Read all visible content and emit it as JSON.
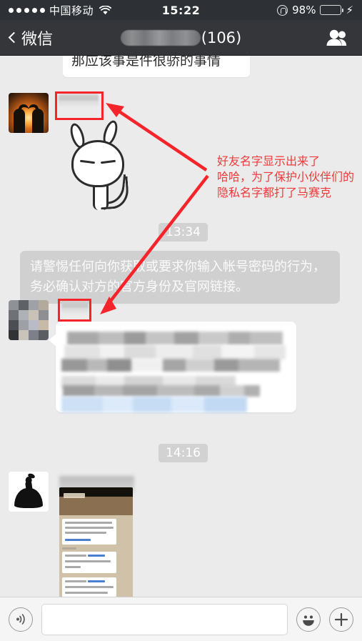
{
  "status_bar": {
    "signal_dots": 5,
    "carrier": "中国移动",
    "wifi_icon": "wifi-icon",
    "time": "15:22",
    "rotation_lock_icon": "rotation-lock-icon",
    "battery_percent": "98%",
    "battery_level": 98,
    "battery_color": "#4cd964",
    "charging_icon": "lightning-bolt-icon"
  },
  "nav_bar": {
    "back_icon": "chevron-left-icon",
    "back_label": "微信",
    "title_redacted": true,
    "title_suffix": "(106)",
    "contacts_icon": "group-members-icon",
    "background_color": "#343639"
  },
  "chat": {
    "background_color": "#ebebeb",
    "messages": [
      {
        "id": "msg-partial-top",
        "type": "text",
        "side": "incoming",
        "text": "那应该事是件很骄的事情",
        "clipped": true
      },
      {
        "id": "msg-sticker",
        "type": "sticker",
        "side": "incoming",
        "avatar": "sunset-couple-avatar",
        "sender_name_redacted": true,
        "sticker_name": "rabbit-sticker"
      },
      {
        "id": "msg-timestamp-1334",
        "type": "timestamp",
        "text": "13:34"
      },
      {
        "id": "msg-security-warning",
        "type": "system",
        "text": "请警惕任何向你获取或要求你输入帐号密码的行为，务必确认对方的官方身份及官网链接。"
      },
      {
        "id": "msg-blurred-text",
        "type": "text",
        "side": "incoming",
        "avatar": "mosaic-avatar",
        "sender_name_redacted": true,
        "content_redacted": true,
        "has_link_row": true
      },
      {
        "id": "msg-timestamp-1416",
        "type": "timestamp",
        "text": "14:16"
      },
      {
        "id": "msg-image",
        "type": "image",
        "side": "incoming",
        "avatar": "dress-sketch-avatar",
        "sender_name_redacted": true,
        "image_description": "phone-screenshot-thumbnail"
      }
    ]
  },
  "annotation": {
    "color": "#ee3a3a",
    "lines": [
      "好友名字显示出来了",
      "哈哈，为了保护小伙伴们的",
      "隐私名字都打了马赛克"
    ],
    "highlight_boxes": 2,
    "arrows": 2
  },
  "toolbar": {
    "voice_icon": "voice-input-icon",
    "input_value": "",
    "input_placeholder": "",
    "emoji_icon": "smiley-face-icon",
    "plus_icon": "plus-icon"
  }
}
